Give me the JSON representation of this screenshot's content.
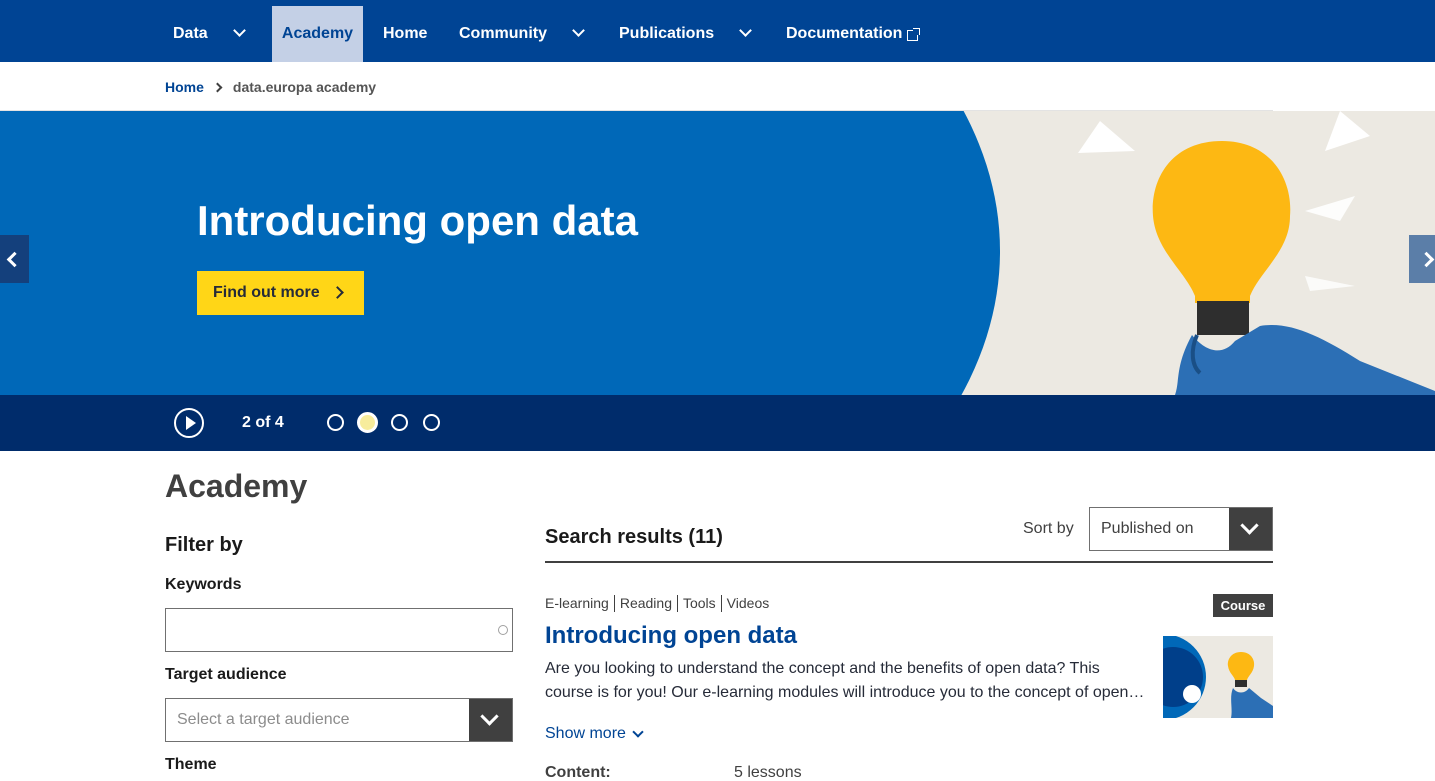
{
  "nav": {
    "items": [
      {
        "label": "Data",
        "has_dropdown": true
      },
      {
        "label": "Academy",
        "active": true
      },
      {
        "label": "Home"
      },
      {
        "label": "Community",
        "has_dropdown": true
      },
      {
        "label": "Publications",
        "has_dropdown": true
      },
      {
        "label": "Documentation",
        "external": true
      }
    ]
  },
  "breadcrumb": {
    "home": "Home",
    "current": "data.europa academy"
  },
  "hero": {
    "title": "Introducing open data",
    "cta_label": "Find out more"
  },
  "carousel": {
    "counter": "2 of 4",
    "total_slides": 4,
    "active_slide": 2
  },
  "page": {
    "title": "Academy"
  },
  "filters": {
    "title": "Filter by",
    "keywords_label": "Keywords",
    "keywords_value": "",
    "audience_label": "Target audience",
    "audience_placeholder": "Select a target audience",
    "theme_label": "Theme"
  },
  "results": {
    "title": "Search results (11)",
    "sort_label": "Sort by",
    "sort_value": "Published on",
    "items": [
      {
        "tags": [
          "E-learning",
          "Reading",
          "Tools",
          "Videos"
        ],
        "badge": "Course",
        "title": "Introducing open data",
        "desc_line1": "Are you looking to understand the concept and the benefits of open data? This",
        "desc_line2": "course is for you! Our e-learning modules will introduce you to the concept of open…",
        "show_more": "Show more",
        "content_label": "Content:",
        "content_value": "5 lessons"
      }
    ]
  },
  "colors": {
    "nav_bg": "#004494",
    "nav_active_bg": "#c4d0e6",
    "hero_blue": "#0068b8",
    "cta_yellow": "#ffd617",
    "carousel_bar": "#002c6b",
    "bulb_yellow": "#fdb813",
    "link_blue": "#004494"
  }
}
